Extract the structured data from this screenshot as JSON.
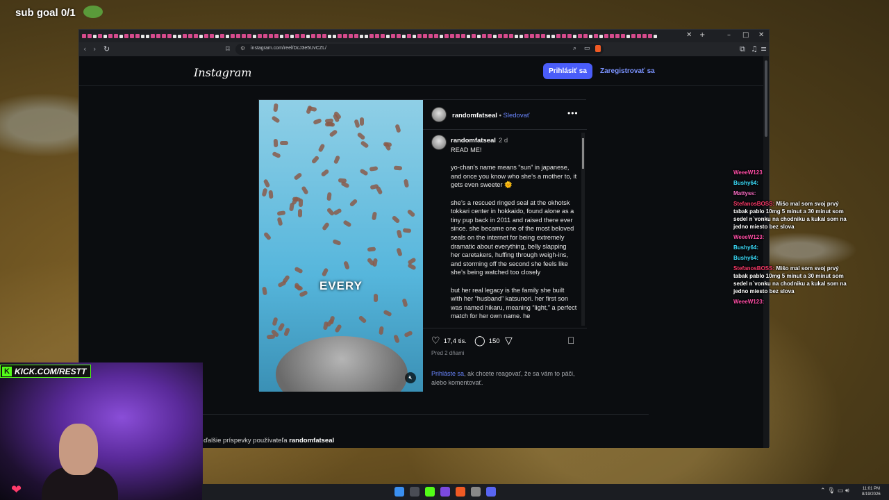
{
  "stream_overlay": {
    "sub_goal": "sub goal 0/1",
    "kick_channel": "KICK.COM/RESTT"
  },
  "browser": {
    "url": "instagram.com/reel/DcJ3e5UvCZL/",
    "window_controls": [
      "–",
      "□",
      "✕"
    ],
    "new_tab_icon": "+",
    "close_tab_icon": "✕"
  },
  "instagram": {
    "logo": "Instagram",
    "login_button": "Prihlásiť sa",
    "signup_link": "Zaregistrovať sa",
    "post": {
      "video_caption_word": "EVERY",
      "author": "randomfatseal",
      "separator": " • ",
      "follow": "Sledovať",
      "comment_author": "randomfatseal",
      "comment_time": "2 d",
      "comment_text": "READ ME!\n\nyo-chan’s name means “sun” in japanese, and once you know who she’s a mother to, it gets even sweeter 🌞\n\nshe’s a rescued ringed seal at the okhotsk tokkari center in hokkaido, found alone as a tiny pup back in 2011 and raised there ever since. she became one of the most beloved seals on the internet for being extremely dramatic about everything, belly slapping her caretakers, huffing through weigh-ins, and storming off the second she feels like she’s being watched too closely\n\nbut her real legacy is the family she built with her “husband” katsunori. her first son was named hikaru, meaning “light,” a perfect match for her own name. he",
      "likes": "17,4 tis.",
      "comments": "150",
      "posted": "Pred 2 dňami",
      "login_prompt_link": "Prihláste sa",
      "login_prompt_rest": ", ak chcete reagovať, že sa vám to páči, alebo komentovať."
    },
    "more_posts_prefix": "ďalšie príspevky používateľa ",
    "more_posts_user": "randomfatseal"
  },
  "chat": [
    {
      "user": "WeeeW123",
      "msg": "",
      "color": "#ff4fa7"
    },
    {
      "user": "Bushy64:",
      "msg": "",
      "color": "#3de0ff"
    },
    {
      "user": "Mattyss:",
      "msg": "",
      "color": "#ff6fc9"
    },
    {
      "user": "StefanosBOSS:",
      "msg": "Mišo mal som svoj prvý tabak pablo 10mg 5 minut a 30 minut som sedel n´vonku na chodniku a kukal som na jedno miesto bez slova",
      "color": "#ff3b6b"
    },
    {
      "user": "WeeeW123:",
      "msg": "",
      "color": "#ff4fa7"
    },
    {
      "user": "Bushy64:",
      "msg": "",
      "color": "#3de0ff"
    },
    {
      "user": "Bushy64:",
      "msg": "",
      "color": "#3de0ff"
    },
    {
      "user": "StefanosBOSS:",
      "msg": "Mišo mal som svoj prvý tabak pablo 10mg 5 minut a 30 minut som sedel n´vonku na chodniku a kukal som na jedno miesto bez slova",
      "color": "#ff3b6b"
    },
    {
      "user": "WeeeW123:",
      "msg": "",
      "color": "#ff4fa7"
    }
  ],
  "taskbar": {
    "clock_time": "11:01 PM",
    "clock_date": "8/19/2026"
  }
}
